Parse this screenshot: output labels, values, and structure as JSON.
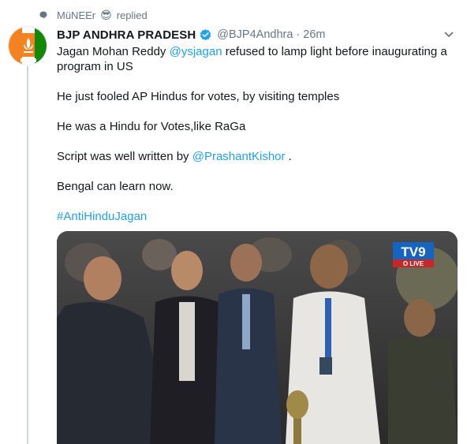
{
  "context": {
    "user": "MüNEEr",
    "emoji": "😎",
    "action": "replied"
  },
  "tweet": {
    "name": "BJP ANDHRA PRADESH",
    "handle": "@BJP4Andhra",
    "separator": "·",
    "time": "26m",
    "line1_a": "Jagan Mohan Reddy ",
    "line1_mention": "@ysjagan",
    "line1_b": " refused to lamp light before inaugurating a",
    "line1_c": "program in US",
    "line2": "He just fooled AP Hindus for votes, by visiting temples",
    "line3": "He was a Hindu for Votes,like RaGa",
    "line4_a": "Script was well written by ",
    "line4_mention": "@PrashantKishor",
    "line4_b": " .",
    "line5": "Bengal can learn now.",
    "hashtag": "#AntiHinduJagan"
  },
  "media": {
    "logo_main": "TV9",
    "logo_sub": "O LIVE"
  },
  "colors": {
    "accent": "#1da1f2",
    "muted": "#657786",
    "text": "#14171a",
    "bjp_orange": "#f58220",
    "bjp_green": "#138808"
  }
}
